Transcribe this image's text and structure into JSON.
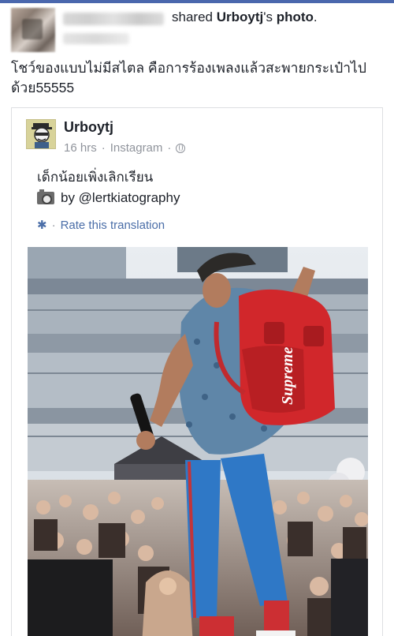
{
  "post": {
    "action_text": "shared",
    "shared_owner": "Urboytj",
    "shared_owner_suffix": "'s",
    "shared_object": "photo",
    "period": ".",
    "body_text": "โชว์ของแบบไม่มีสไตล คือการร้องเพลงแล้วสะพายกระเป๋าไปด้วย55555"
  },
  "shared_card": {
    "author": "Urboytj",
    "time": "16 hrs",
    "source": "Instagram",
    "separator": "·",
    "caption_line1": "เด็กน้อยเพิ่งเลิกเรียน",
    "caption_credit": "by @lertkiatography",
    "translate_label": "Rate this translation"
  },
  "icons": {
    "globe": "globe-icon",
    "gear": "gear-icon",
    "camera": "camera-icon"
  },
  "colors": {
    "link": "#4b6ea8",
    "meta": "#90949c",
    "text": "#1d2129",
    "backpack": "#d1272b",
    "jacket": "#5f86a8",
    "pants": "#2f78c6"
  }
}
